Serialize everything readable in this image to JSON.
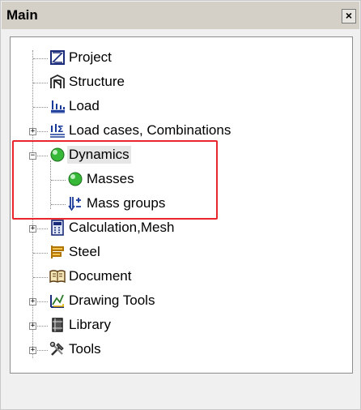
{
  "panel": {
    "title": "Main",
    "close_label": "×"
  },
  "tree": {
    "items": [
      {
        "label": "Project",
        "icon": "project-icon",
        "expandable": false
      },
      {
        "label": "Structure",
        "icon": "structure-icon",
        "expandable": false
      },
      {
        "label": "Load",
        "icon": "load-icon",
        "expandable": false
      },
      {
        "label": "Load cases, Combinations",
        "icon": "load-cases-icon",
        "expandable": true,
        "expanded": false
      },
      {
        "label": "Dynamics",
        "icon": "dynamics-icon",
        "expandable": true,
        "expanded": true,
        "selected": true,
        "children": [
          {
            "label": "Masses",
            "icon": "masses-icon"
          },
          {
            "label": "Mass groups",
            "icon": "mass-groups-icon"
          }
        ]
      },
      {
        "label": "Calculation,Mesh",
        "icon": "calculation-icon",
        "expandable": true,
        "expanded": false
      },
      {
        "label": "Steel",
        "icon": "steel-icon",
        "expandable": false
      },
      {
        "label": "Document",
        "icon": "document-icon",
        "expandable": false
      },
      {
        "label": "Drawing Tools",
        "icon": "drawing-tools-icon",
        "expandable": true,
        "expanded": false
      },
      {
        "label": "Library",
        "icon": "library-icon",
        "expandable": true,
        "expanded": false
      },
      {
        "label": "Tools",
        "icon": "tools-icon",
        "expandable": true,
        "expanded": false
      }
    ]
  },
  "colors": {
    "highlight": "#e8262c",
    "tree_background": "#ffffff",
    "panel_background": "#f0f0f0"
  }
}
